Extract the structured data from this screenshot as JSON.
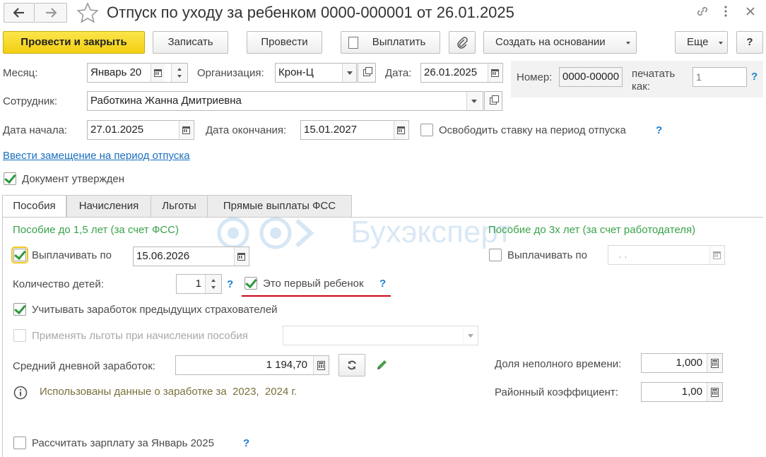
{
  "window": {
    "title": "Отпуск по уходу за ребенком 0000-000001 от 26.01.2025"
  },
  "toolbar": {
    "post_close": "Провести и закрыть",
    "save": "Записать",
    "post": "Провести",
    "pay": "Выплатить",
    "create_based": "Создать на основании",
    "more": "Еще",
    "help": "?"
  },
  "header": {
    "month_label": "Месяц:",
    "month_value": "Январь 20",
    "org_label": "Организация:",
    "org_value": "Крон-Ц",
    "date_label": "Дата:",
    "date_value": "26.01.2025",
    "number_label": "Номер:",
    "number_value": "0000-00000",
    "print_as_label": "печатать как:",
    "print_as_placeholder": "1",
    "employee_label": "Сотрудник:",
    "employee_value": "Работкина Жанна Дмитриевна",
    "start_label": "Дата начала:",
    "start_value": "27.01.2025",
    "end_label": "Дата окончания:",
    "end_value": "15.01.2027",
    "free_rate_label": "Освободить ставку на период отпуска",
    "replacement_link": "Ввести замещение на период отпуска",
    "approved_label": "Документ утвержден"
  },
  "tabs": [
    "Пособия",
    "Начисления",
    "Льготы",
    "Прямые выплаты ФСС"
  ],
  "benefits": {
    "left_title": "Пособие до 1,5 лет (за счет ФСС)",
    "right_title": "Пособие до 3х лет (за счет работодателя)",
    "pay_until_label": "Выплачивать по",
    "pay_until_value": "15.06.2026",
    "pay_until_right_label": "Выплачивать по",
    "pay_until_right_value": ".   .",
    "children_label": "Количество детей:",
    "children_value": "1",
    "first_child_label": "Это первый ребенок",
    "consider_prev_label": "Учитывать заработок предыдущих страхователей",
    "apply_benefits_label": "Применять льготы при начислении пособия",
    "avg_daily_label": "Средний дневной заработок:",
    "avg_daily_value": "1 194,70",
    "info_text": "Использованы данные о заработке за  2023,  2024 г.",
    "part_time_label": "Доля неполного времени:",
    "part_time_value": "1,000",
    "regional_label": "Районный коэффициент:",
    "regional_value": "1,00",
    "calc_salary_label": "Рассчитать зарплату за Январь 2025"
  },
  "watermark": "Бухэксперт",
  "colors": {
    "accent_yellow": "#f3cf12",
    "green_heading": "#3aa24a",
    "link_blue": "#1a6fc0",
    "underline_red": "#d0021b"
  }
}
